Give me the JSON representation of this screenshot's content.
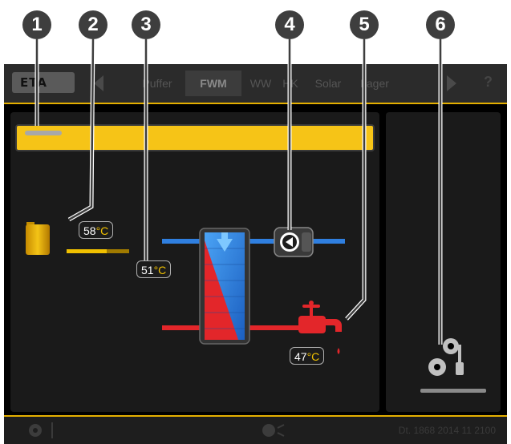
{
  "callouts": [
    "1",
    "2",
    "3",
    "4",
    "5",
    "6"
  ],
  "header": {
    "logo_text": "ETA",
    "tabs": [
      "Puffer",
      "FWM",
      "WW",
      "HK",
      "Solar",
      "Lager"
    ],
    "active_tab": "FWM",
    "help": "?"
  },
  "temps": {
    "buffer": {
      "value": "58",
      "unit": "°C"
    },
    "exchanger": {
      "value": "51",
      "unit": "°C"
    },
    "tap": {
      "value": "47",
      "unit": "°C"
    }
  },
  "footer": {
    "serial": "Dt. 1868 2014 11 2100"
  },
  "colors": {
    "accent": "#f6c417",
    "hot": "#e3262a",
    "cold": "#2f7fe0"
  },
  "icons": [
    "gear-icon",
    "globe-icon",
    "pump-icon",
    "tap-icon",
    "settings-icon",
    "buffer-tank-icon",
    "arrow-left-icon",
    "arrow-right-icon"
  ]
}
